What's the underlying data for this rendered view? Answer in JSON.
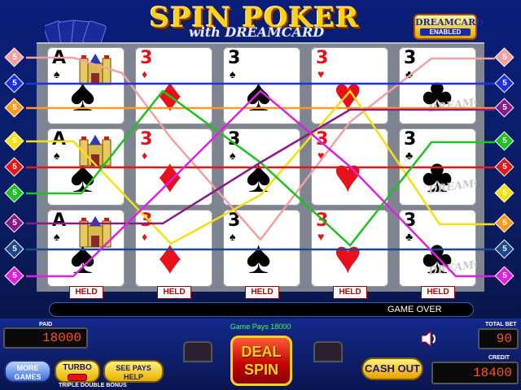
{
  "header": {
    "title": "SPIN POKER",
    "subtitle": "with DREAMCARD",
    "badge_line1": "DREAMCARD",
    "badge_line2": "ENABLED"
  },
  "grid": {
    "columns": [
      {
        "rank": "A",
        "suit": "♠",
        "color": "black",
        "special": "castle"
      },
      {
        "rank": "3",
        "suit": "♦",
        "color": "red",
        "special": ""
      },
      {
        "rank": "3",
        "suit": "♠",
        "color": "black",
        "special": ""
      },
      {
        "rank": "3",
        "suit": "♥",
        "color": "red",
        "special": ""
      },
      {
        "rank": "3",
        "suit": "♣",
        "color": "black",
        "special": "dreamcard"
      }
    ],
    "held_label": "HELD",
    "watermark": "DREAMCARD"
  },
  "paylines": {
    "left": [
      {
        "number": "5",
        "color": "#f4a0a0"
      },
      {
        "number": "5",
        "color": "#2030e0"
      },
      {
        "number": "5",
        "color": "#ff9a20"
      },
      {
        "number": "5",
        "color": "#f8e010"
      },
      {
        "number": "5",
        "color": "#e01818"
      },
      {
        "number": "5",
        "color": "#20c020"
      },
      {
        "number": "5",
        "color": "#8a1a8a"
      },
      {
        "number": "5",
        "color": "#1a4a8a"
      },
      {
        "number": "5",
        "color": "#e020e0"
      }
    ],
    "right": [
      {
        "number": "5",
        "color": "#f4a0a0"
      },
      {
        "number": "5",
        "color": "#2030e0"
      },
      {
        "number": "5",
        "color": "#8a1a8a"
      },
      {
        "number": "5",
        "color": "#20c020"
      },
      {
        "number": "5",
        "color": "#e01818"
      },
      {
        "number": "5",
        "color": "#f8e010"
      },
      {
        "number": "5",
        "color": "#ff9a20"
      },
      {
        "number": "5",
        "color": "#1a4a8a"
      },
      {
        "number": "5",
        "color": "#e020e0"
      }
    ]
  },
  "status": {
    "message": "GAME OVER",
    "game_pays": "Game Pays 18000"
  },
  "meters": {
    "paid_label": "PAID",
    "paid_value": "18000",
    "total_bet_label": "TOTAL BET",
    "total_bet_value": "90",
    "credit_label": "CREDIT",
    "credit_value": "18400"
  },
  "buttons": {
    "more_games": "MORE GAMES",
    "turbo": "TURBO",
    "see_pays": "SEE PAYS HELP",
    "deal_spin": "DEAL SPIN",
    "cash_out": "CASH OUT"
  },
  "footer": {
    "game_name": "TRIPLE DOUBLE BONUS"
  },
  "icons": {
    "speaker": "speaker-icon"
  }
}
